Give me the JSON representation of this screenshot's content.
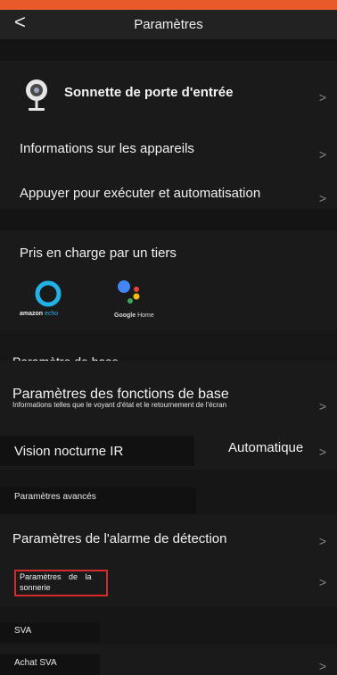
{
  "header": {
    "back_symbol": "<",
    "title": "Paramètres"
  },
  "device": {
    "name": "Sonnette de porte d'entrée"
  },
  "rows": {
    "device_info": "Informations sur les appareils",
    "automation": "Appuyer pour exécuter et automatisation",
    "third_party": "Pris en charge par un tiers"
  },
  "third_party": {
    "amazon_label_strong": "amazon",
    "amazon_label_light": " echo",
    "google_label_strong": "Google",
    "google_label_light": " Home"
  },
  "sections": {
    "basic": "Paramètre de base",
    "advanced": "Paramètres avancés",
    "sva": "SVA"
  },
  "basic_functions": {
    "title": "Paramètres des fonctions de base",
    "subtitle": "Informations telles que le voyant d'état et le retournement de l'écran"
  },
  "night_vision": {
    "label": "Vision nocturne IR",
    "value": "Automatique"
  },
  "detection_alarm": "Paramètres de l'alarme de détection",
  "ringtone": {
    "line1": "Paramètres de la",
    "line2": "sonnerie"
  },
  "buy_sva": "Achat SVA",
  "chevron": ">",
  "colors": {
    "accent_bar": "#e85a2a",
    "highlight_border": "#d42a2a"
  }
}
